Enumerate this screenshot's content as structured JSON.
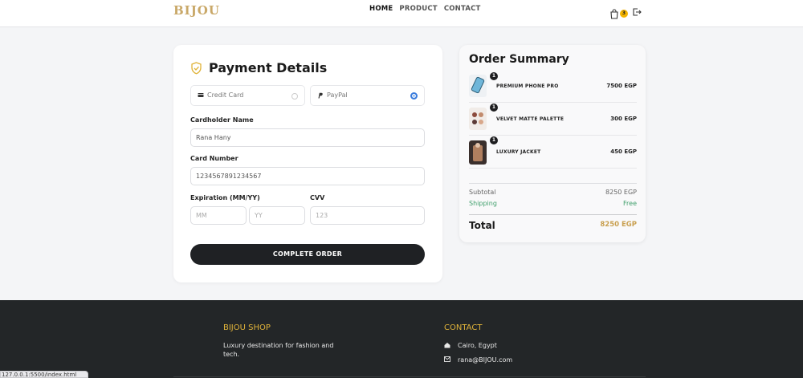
{
  "header": {
    "logo": "BIJOU",
    "nav": [
      {
        "label": "HOME",
        "active": true
      },
      {
        "label": "PRODUCT",
        "active": false
      },
      {
        "label": "CONTACT",
        "active": false
      }
    ],
    "cart_count": "3",
    "icons": [
      "shopping-bag-icon",
      "logout-icon"
    ]
  },
  "payment": {
    "title": "Payment Details",
    "methods": [
      {
        "label": "Credit Card",
        "selected": false,
        "icon": "credit-card-icon"
      },
      {
        "label": "PayPal",
        "selected": true,
        "icon": "paypal-icon"
      }
    ],
    "cardholder_label": "Cardholder Name",
    "cardholder_value": "Rana Hany",
    "card_number_label": "Card Number",
    "card_number_value": "1234567891234567",
    "expiration_label": "Expiration (MM/YY)",
    "mm_placeholder": "MM",
    "yy_placeholder": "YY",
    "cvv_label": "CVV",
    "cvv_placeholder": "123",
    "submit_label": "COMPLETE ORDER"
  },
  "summary": {
    "title": "Order Summary",
    "items": [
      {
        "name": "PREMIUM PHONE PRO",
        "price": "7500 EGP",
        "qty": "1"
      },
      {
        "name": "VELVET MATTE PALETTE",
        "price": "300 EGP",
        "qty": "1"
      },
      {
        "name": "LUXURY JACKET",
        "price": "450 EGP",
        "qty": "1"
      }
    ],
    "subtotal_label": "Subtotal",
    "subtotal_value": "8250 EGP",
    "shipping_label": "Shipping",
    "shipping_value": "Free",
    "total_label": "Total",
    "total_value": "8250 EGP"
  },
  "footer": {
    "shop_title": "BIJOU SHOP",
    "shop_desc": "Luxury destination for fashion and tech.",
    "contact_title": "CONTACT",
    "address": "Cairo, Egypt",
    "email": "rana@BIJOU.com"
  },
  "status_url": "127.0.0.1:5500/index.html",
  "colors": {
    "gold": "#c9a868",
    "accent_yellow": "#e0b33a",
    "dark": "#1f2124",
    "green": "#3f9f6b",
    "radio_blue": "#3b7ddd"
  }
}
